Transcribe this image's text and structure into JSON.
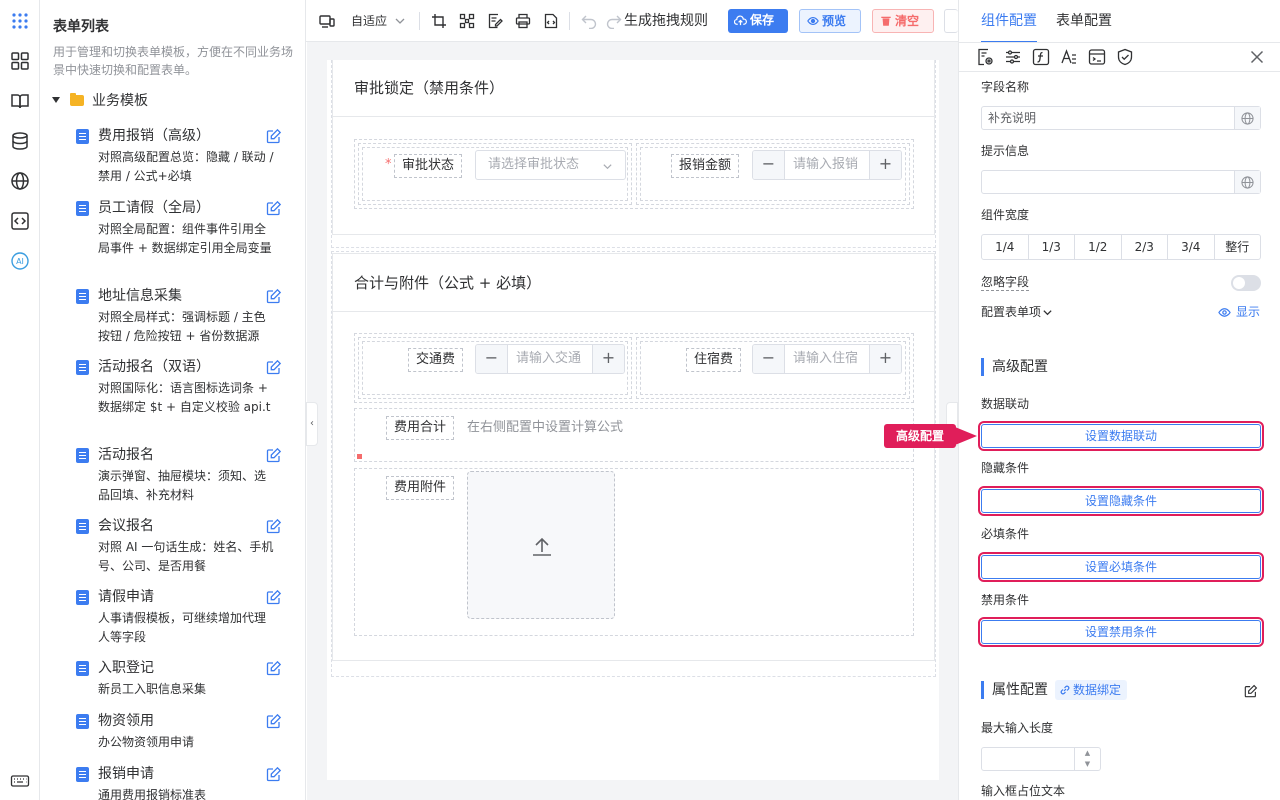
{
  "sidebar": {
    "title": "表单列表",
    "description": "用于管理和切换表单模板，方便在不同业务场景中快速切换和配置表单。",
    "group": "业务模板",
    "items": [
      {
        "name": "费用报销（高级）",
        "desc": "对照高级配置总览：隐藏 / 联动 / 禁用 / 公式+必填"
      },
      {
        "name": "员工请假（全局）",
        "desc": "对照全局配置：组件事件引用全局事件 + 数据绑定引用全局变量"
      },
      {
        "name": "地址信息采集",
        "desc": "对照全局样式：强调标题 / 主色按钮 / 危险按钮 + 省份数据源"
      },
      {
        "name": "活动报名（双语）",
        "desc": "对照国际化：语言图标选词条 + 数据绑定 $t + 自定义校验 api.t"
      },
      {
        "name": "活动报名",
        "desc": "演示弹窗、抽屉模块：须知、选品回填、补充材料"
      },
      {
        "name": "会议报名",
        "desc": "对照 AI 一句话生成：姓名、手机号、公司、是否用餐"
      },
      {
        "name": "请假申请",
        "desc": "人事请假模板，可继续增加代理人等字段"
      },
      {
        "name": "入职登记",
        "desc": "新员工入职信息采集"
      },
      {
        "name": "物资领用",
        "desc": "办公物资领用申请"
      },
      {
        "name": "报销申请",
        "desc": "通用费用报销标准表"
      }
    ]
  },
  "toolbar": {
    "adaptive_label": "自适应",
    "generate_rules": "生成拖拽规则",
    "save": "保存",
    "preview": "预览",
    "clear": "清空"
  },
  "canvas": {
    "section1_title": "审批锁定（禁用条件）",
    "approval_status_label": "审批状态",
    "approval_status_placeholder": "请选择审批状态",
    "reimburse_amount_label": "报销金额",
    "reimburse_amount_placeholder": "请输入报销",
    "section2_title": "合计与附件（公式 + 必填）",
    "transport_label": "交通费",
    "transport_placeholder": "请输入交通",
    "lodging_label": "住宿费",
    "lodging_placeholder": "请输入住宿",
    "total_label": "费用合计",
    "total_hint": "在右侧配置中设置计算公式",
    "attachment_label": "费用附件"
  },
  "right_panel": {
    "tabs": [
      "组件配置",
      "表单配置"
    ],
    "field_name_label": "字段名称",
    "field_name_value": "补充说明",
    "hint_label": "提示信息",
    "hint_value": "",
    "width_label": "组件宽度",
    "width_options": [
      "1/4",
      "1/3",
      "1/2",
      "2/3",
      "3/4",
      "整行"
    ],
    "ignore_label": "忽略字段",
    "config_items_label": "配置表单项",
    "show_label": "显示",
    "advanced_title": "高级配置",
    "linkage_label": "数据联动",
    "linkage_button": "设置数据联动",
    "hide_label": "隐藏条件",
    "hide_button": "设置隐藏条件",
    "required_label": "必填条件",
    "required_button": "设置必填条件",
    "disable_label": "禁用条件",
    "disable_button": "设置禁用条件",
    "props_title": "属性配置",
    "data_binding": "数据绑定",
    "max_length_label": "最大输入长度",
    "placeholder_label": "输入框占位文本"
  },
  "callout": {
    "text": "高级配置"
  },
  "colors": {
    "primary": "#3c7cf0",
    "danger": "#f56c6c",
    "highlight": "#e01e5a",
    "folder": "#f5b324"
  }
}
